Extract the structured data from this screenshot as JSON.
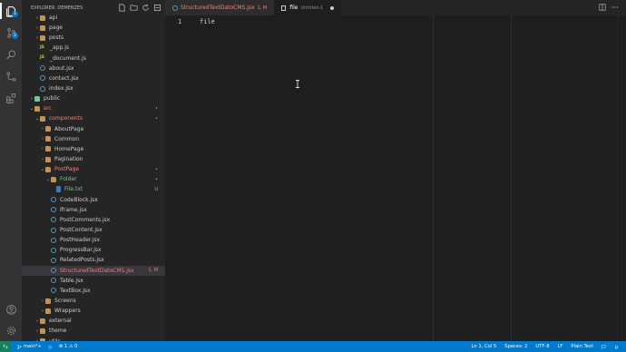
{
  "sidebar": {
    "title": "EXPLORER: DEMENZES",
    "tree": [
      {
        "label": "api",
        "type": "folder",
        "depth": 1,
        "chevron": "›"
      },
      {
        "label": "page",
        "type": "folder",
        "depth": 1,
        "chevron": "›"
      },
      {
        "label": "posts",
        "type": "folder",
        "depth": 1,
        "chevron": "›"
      },
      {
        "label": "_app.js",
        "type": "js",
        "depth": 1
      },
      {
        "label": "_document.js",
        "type": "js",
        "depth": 1
      },
      {
        "label": "about.jsx",
        "type": "react",
        "depth": 1
      },
      {
        "label": "contact.jsx",
        "type": "react",
        "depth": 1
      },
      {
        "label": "index.jsx",
        "type": "react",
        "depth": 1
      },
      {
        "label": "public",
        "type": "folder-green",
        "depth": 0,
        "chevron": "›"
      },
      {
        "label": "src",
        "type": "folder",
        "depth": 0,
        "chevron": "⌄",
        "state": "red",
        "mark": "•"
      },
      {
        "label": "components",
        "type": "folder",
        "depth": 1,
        "chevron": "⌄",
        "state": "red",
        "mark": "•"
      },
      {
        "label": "AboutPage",
        "type": "folder",
        "depth": 2,
        "chevron": "›"
      },
      {
        "label": "Common",
        "type": "folder",
        "depth": 2,
        "chevron": "›"
      },
      {
        "label": "HomePage",
        "type": "folder",
        "depth": 2,
        "chevron": "›"
      },
      {
        "label": "Pagination",
        "type": "folder",
        "depth": 2,
        "chevron": "›"
      },
      {
        "label": "PostPage",
        "type": "folder",
        "depth": 2,
        "chevron": "⌄",
        "state": "red",
        "mark": "•"
      },
      {
        "label": "Folder",
        "type": "folder",
        "depth": 3,
        "chevron": "⌄",
        "state": "green",
        "mark": "•"
      },
      {
        "label": "File.txt",
        "type": "txt",
        "depth": 4,
        "state": "green",
        "mark": "U"
      },
      {
        "label": "CodeBlock.jsx",
        "type": "react",
        "depth": 3
      },
      {
        "label": "Iframe.jsx",
        "type": "react",
        "depth": 3
      },
      {
        "label": "PostComments.jsx",
        "type": "react",
        "depth": 3
      },
      {
        "label": "PostContent.jsx",
        "type": "react",
        "depth": 3
      },
      {
        "label": "PostHeader.jsx",
        "type": "react",
        "depth": 3
      },
      {
        "label": "ProgressBar.jsx",
        "type": "react",
        "depth": 3
      },
      {
        "label": "RelatedPosts.jsx",
        "type": "react",
        "depth": 3
      },
      {
        "label": "StructuredTextDatoCMS.jsx",
        "type": "react",
        "depth": 3,
        "state": "sel",
        "mark": "1, M"
      },
      {
        "label": "Table.jsx",
        "type": "react",
        "depth": 3
      },
      {
        "label": "TextBox.jsx",
        "type": "react",
        "depth": 3
      },
      {
        "label": "Screens",
        "type": "folder",
        "depth": 2,
        "chevron": "›"
      },
      {
        "label": "Wrappers",
        "type": "folder",
        "depth": 2,
        "chevron": "›"
      },
      {
        "label": "external",
        "type": "folder",
        "depth": 1,
        "chevron": "›"
      },
      {
        "label": "theme",
        "type": "folder",
        "depth": 1,
        "chevron": "›"
      },
      {
        "label": "utils",
        "type": "folder",
        "depth": 1,
        "chevron": "›"
      }
    ]
  },
  "tabs": [
    {
      "label": "StructuredTextDatoCMS.jsx",
      "sub": "1, M",
      "active": false
    },
    {
      "label": "file",
      "sub": "Untitled-1",
      "active": true,
      "dirty": true
    }
  ],
  "editor": {
    "line_number": "1",
    "line_text": "file"
  },
  "status": {
    "branch": "main*+",
    "problems": "⊗ 1 ⚠ 0",
    "position": "Ln 1, Col 5",
    "spaces": "Spaces: 2",
    "encoding": "UTF-8",
    "eol": "LF",
    "language": "Plain Text"
  },
  "colors": {
    "accent": "#007acc",
    "modified": "#f88070",
    "untracked": "#73c991"
  }
}
